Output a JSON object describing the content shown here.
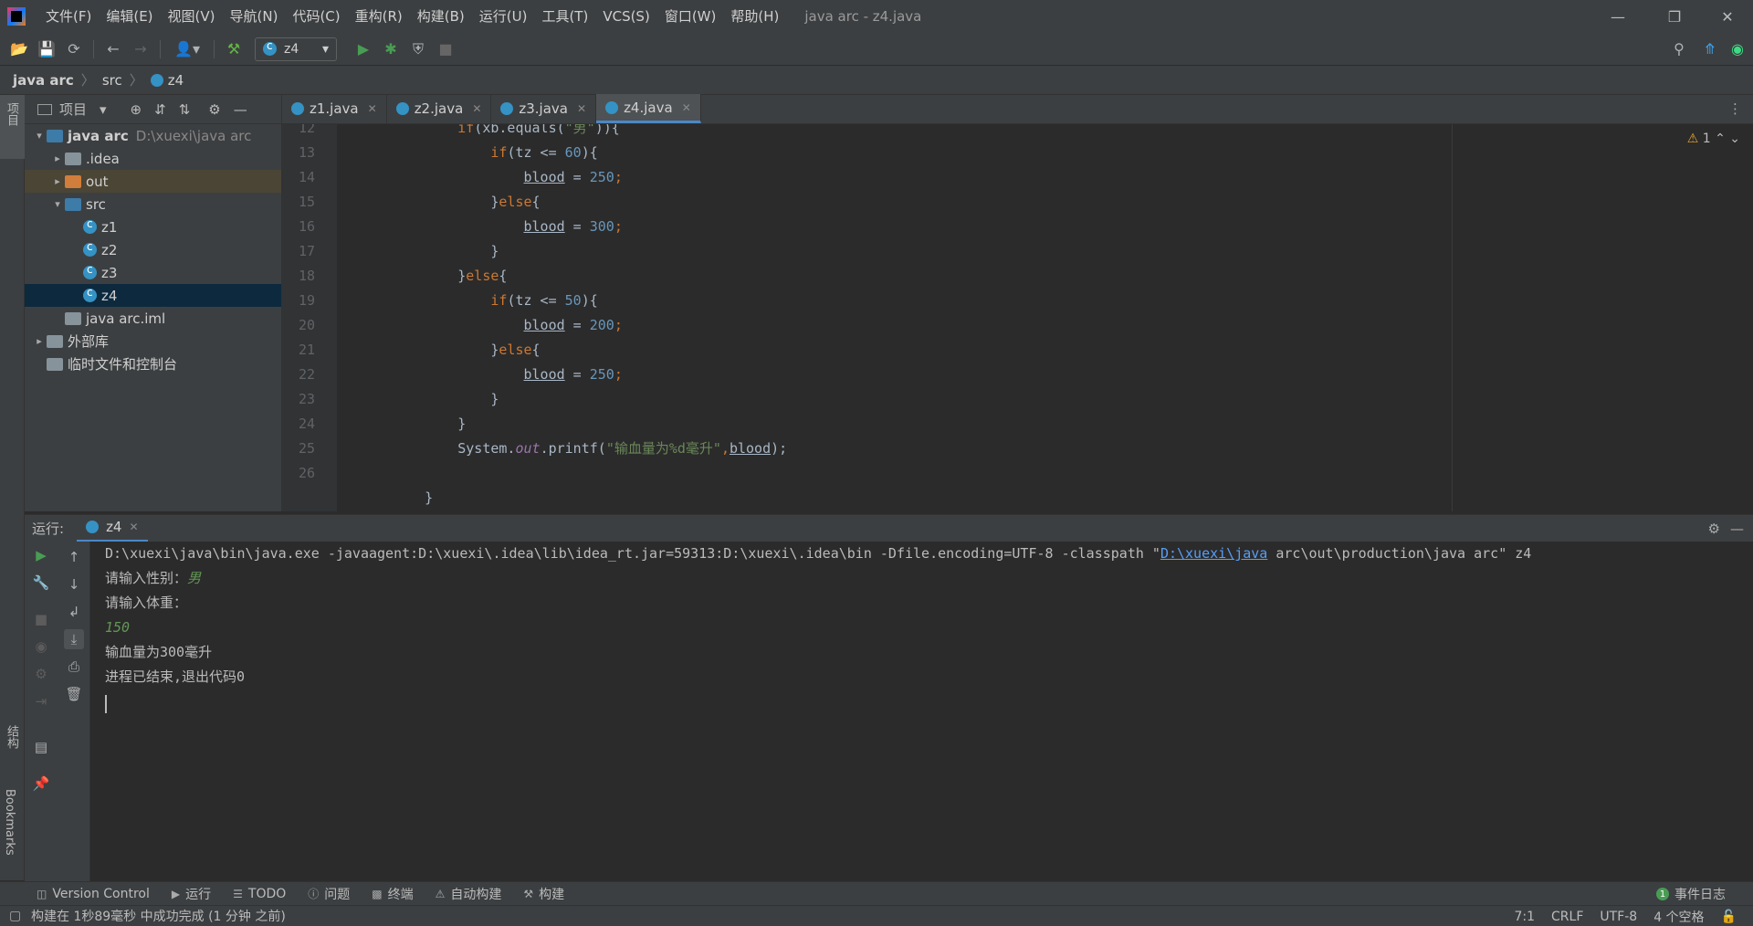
{
  "menubar": {
    "items": [
      "文件(F)",
      "编辑(E)",
      "视图(V)",
      "导航(N)",
      "代码(C)",
      "重构(R)",
      "构建(B)",
      "运行(U)",
      "工具(T)",
      "VCS(S)",
      "窗口(W)",
      "帮助(H)"
    ],
    "window_title": "java arc - z4.java"
  },
  "toolbar": {
    "run_config": "z4"
  },
  "breadcrumb": [
    "java arc",
    "src",
    "z4"
  ],
  "project_panel": {
    "header": "项目",
    "tree": [
      {
        "label": "java arc",
        "hint": "D:\\xuexi\\java arc",
        "depth": 0,
        "arrow": "▾",
        "icon": "module-folder-icon"
      },
      {
        "label": ".idea",
        "depth": 1,
        "arrow": "▸",
        "icon": "folder-icon"
      },
      {
        "label": "out",
        "depth": 1,
        "arrow": "▸",
        "icon": "output-folder-icon"
      },
      {
        "label": "src",
        "depth": 1,
        "arrow": "▾",
        "icon": "source-folder-icon"
      },
      {
        "label": "z1",
        "depth": 2,
        "arrow": "",
        "icon": "java-class-icon"
      },
      {
        "label": "z2",
        "depth": 2,
        "arrow": "",
        "icon": "java-class-icon"
      },
      {
        "label": "z3",
        "depth": 2,
        "arrow": "",
        "icon": "java-class-icon"
      },
      {
        "label": "z4",
        "depth": 2,
        "arrow": "",
        "icon": "java-class-icon"
      },
      {
        "label": "java arc.iml",
        "depth": 1,
        "arrow": "",
        "icon": "iml-file-icon"
      },
      {
        "label": "外部库",
        "depth": 0,
        "arrow": "▸",
        "icon": "library-icon"
      },
      {
        "label": "临时文件和控制台",
        "depth": 0,
        "arrow": "",
        "icon": "scratch-icon"
      }
    ]
  },
  "editor_tabs": [
    "z1.java",
    "z2.java",
    "z3.java",
    "z4.java"
  ],
  "editor": {
    "warnings": "1",
    "lines": [
      {
        "n": "12",
        "html_key": "l12"
      },
      {
        "n": "13",
        "html_key": "l13"
      },
      {
        "n": "14",
        "html_key": "l14"
      },
      {
        "n": "15",
        "html_key": "l15"
      },
      {
        "n": "16",
        "html_key": "l16"
      },
      {
        "n": "17",
        "html_key": "l17"
      },
      {
        "n": "18",
        "html_key": "l18"
      },
      {
        "n": "19",
        "html_key": "l19"
      },
      {
        "n": "20",
        "html_key": "l20"
      },
      {
        "n": "21",
        "html_key": "l21"
      },
      {
        "n": "22",
        "html_key": "l22"
      },
      {
        "n": "23",
        "html_key": "l23"
      },
      {
        "n": "24",
        "html_key": "l24"
      },
      {
        "n": "25",
        "html_key": "l25"
      },
      {
        "n": "26",
        "html_key": "l26"
      }
    ]
  },
  "code": {
    "if_tz60": "if",
    "tz60": "(tz <= ",
    "n60": "60",
    "close_brace_open": "){",
    "blood": "blood",
    "assign": " = ",
    "n250": "250",
    "n300": "300",
    "n200": "200",
    "n50": "50",
    "semi": ";",
    "else_kw": "else",
    "brace_close": "}",
    "brace_open": "{",
    "sys": "System.",
    "out": "out",
    "printf": ".printf(",
    "fmt": "\"输血量为%d毫升\"",
    "comma": ",",
    "tail": ");"
  },
  "run_panel": {
    "label": "运行:",
    "tab": "z4",
    "cmd_prefix": "D:\\xuexi\\java\\bin\\java.exe -javaagent:D:\\xuexi\\.idea\\lib\\idea_rt.jar=59313:D:\\xuexi\\.idea\\bin -Dfile.encoding=UTF-8 -classpath \"",
    "cmd_link": "D:\\xuexi\\java",
    "cmd_suffix": " arc\\out\\production\\java arc\" z4",
    "prompt_gender": "请输入性别：",
    "input_gender": "男",
    "prompt_weight": "请输入体重：",
    "input_weight": "150",
    "result": "输血量为300毫升",
    "exit": "进程已结束,退出代码0"
  },
  "bottom_bar": {
    "items": [
      {
        "label": "Version Control",
        "icon": "version-control-icon"
      },
      {
        "label": "运行",
        "icon": "run-icon"
      },
      {
        "label": "TODO",
        "icon": "todo-icon"
      },
      {
        "label": "问题",
        "icon": "problems-icon"
      },
      {
        "label": "终端",
        "icon": "terminal-icon"
      },
      {
        "label": "自动构建",
        "icon": "warning-icon"
      },
      {
        "label": "构建",
        "icon": "build-icon"
      }
    ],
    "event_log": "事件日志",
    "event_count": "1"
  },
  "status_bar": {
    "message": "构建在 1秒89毫秒 中成功完成 (1 分钟 之前)",
    "position": "7:1",
    "line_sep": "CRLF",
    "encoding": "UTF-8",
    "indent": "4 个空格"
  },
  "left_strip": {
    "project": "项目",
    "structure": "结构",
    "bookmarks": "Bookmarks"
  }
}
